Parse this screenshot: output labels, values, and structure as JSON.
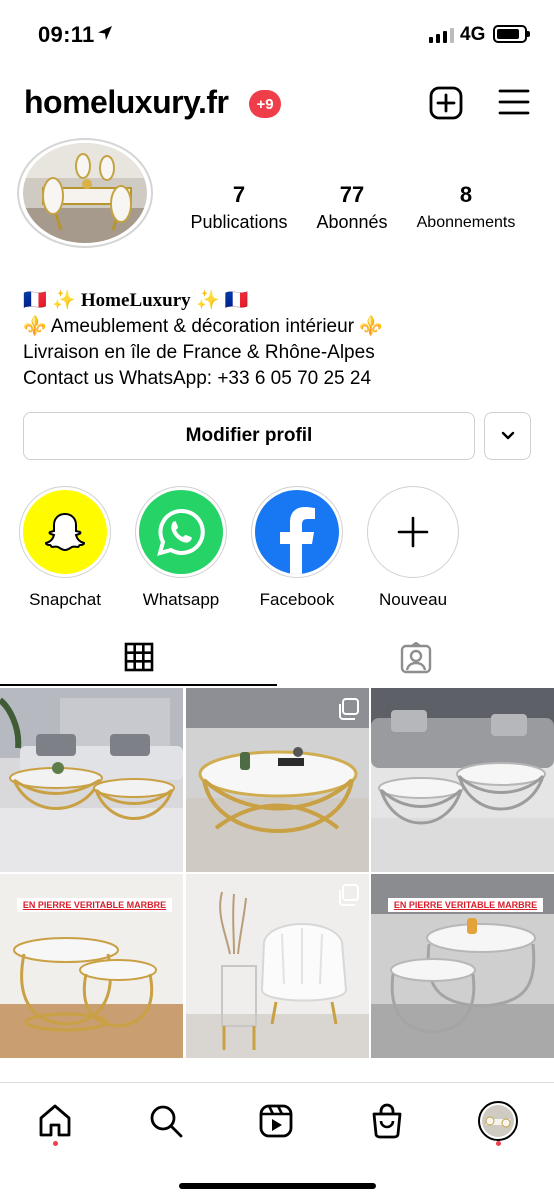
{
  "status_bar": {
    "time": "09:11",
    "network": "4G",
    "battery_level": 0.85
  },
  "header": {
    "username": "homeluxury.fr",
    "notification_count": "+9",
    "icons": [
      "new-post-icon",
      "menu-icon"
    ]
  },
  "profile": {
    "stats": [
      {
        "value": "7",
        "label": "Publications"
      },
      {
        "value": "77",
        "label": "Abonnés"
      },
      {
        "value": "8",
        "label": "Abonnements"
      }
    ],
    "bio": {
      "line1_flag_left": "🇫🇷",
      "line1_spark_left": "✨",
      "name": "HomeLuxury",
      "line1_spark_right": "✨",
      "line1_flag_right": "🇫🇷",
      "fleur_left": "⚜️",
      "line2_text": "Ameublement & décoration intérieur",
      "fleur_right": "⚜️",
      "line3": "Livraison en île de France & Rhône-Alpes",
      "line4": "Contact us WhatsApp: +33 6 05 70 25 24"
    },
    "edit_button_label": "Modifier profil"
  },
  "highlights": [
    {
      "label": "Snapchat",
      "icon": "snapchat-icon",
      "color": "#fffc00"
    },
    {
      "label": "Whatsapp",
      "icon": "whatsapp-icon",
      "color": "#25d366"
    },
    {
      "label": "Facebook",
      "icon": "facebook-icon",
      "color": "#1877f2"
    },
    {
      "label": "Nouveau",
      "icon": "plus-icon",
      "color": "#ffffff"
    }
  ],
  "tabs": [
    {
      "name": "grid",
      "icon": "grid-icon",
      "active": true
    },
    {
      "name": "tagged",
      "icon": "tagged-person-icon",
      "active": false
    }
  ],
  "posts": [
    {
      "banner": "",
      "multi": false
    },
    {
      "banner": "",
      "multi": true
    },
    {
      "banner": "",
      "multi": false
    },
    {
      "banner": "EN PIERRE VERITABLE MARBRE",
      "multi": false
    },
    {
      "banner": "",
      "multi": true
    },
    {
      "banner": "EN PIERRE VERITABLE MARBRE",
      "multi": false
    }
  ],
  "bottom_nav": [
    {
      "name": "home",
      "icon": "home-icon",
      "active_dot": true
    },
    {
      "name": "search",
      "icon": "search-icon",
      "active_dot": false
    },
    {
      "name": "reels",
      "icon": "reels-icon",
      "active_dot": false
    },
    {
      "name": "shop",
      "icon": "shop-bag-icon",
      "active_dot": false
    },
    {
      "name": "profile",
      "icon": "profile-avatar-icon",
      "active_dot": true
    }
  ]
}
